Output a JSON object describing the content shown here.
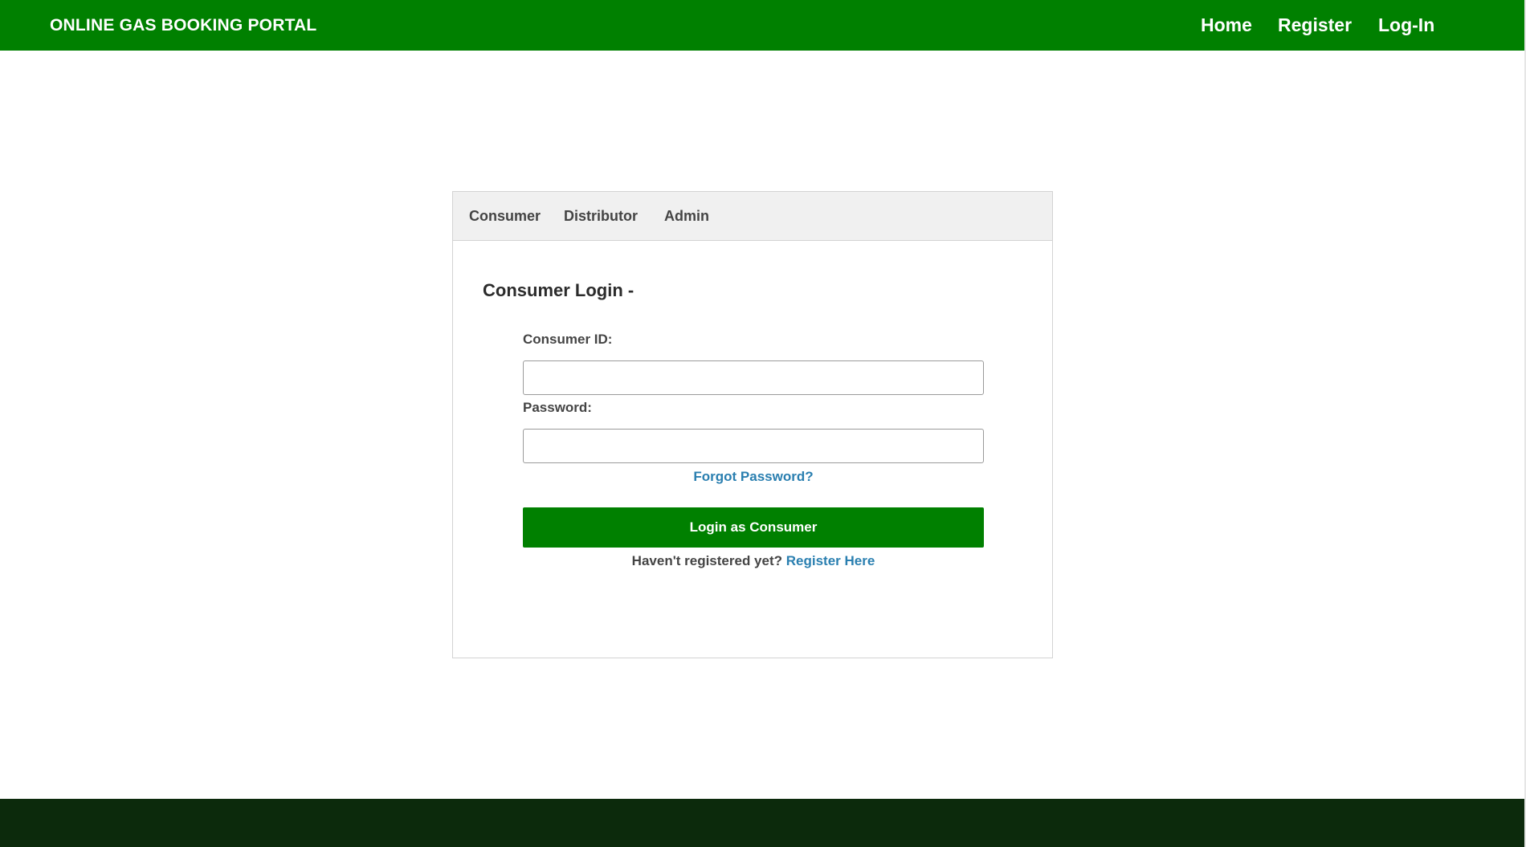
{
  "header": {
    "brand": "ONLINE GAS BOOKING PORTAL",
    "nav": {
      "home": "Home",
      "register": "Register",
      "login": "Log-In"
    }
  },
  "login_card": {
    "tabs": {
      "consumer": "Consumer",
      "distributor": "Distributor",
      "admin": "Admin"
    },
    "title": "Consumer Login -",
    "fields": {
      "consumer_id_label": "Consumer ID:",
      "consumer_id_value": "",
      "password_label": "Password:",
      "password_value": ""
    },
    "forgot_password": "Forgot Password?",
    "submit_label": "Login as Consumer",
    "register_prompt": "Haven't registered yet?",
    "register_link": "Register Here"
  },
  "colors": {
    "brand_green": "#008000",
    "footer": "#0c2a0c",
    "link_blue": "#2a7fb0"
  }
}
